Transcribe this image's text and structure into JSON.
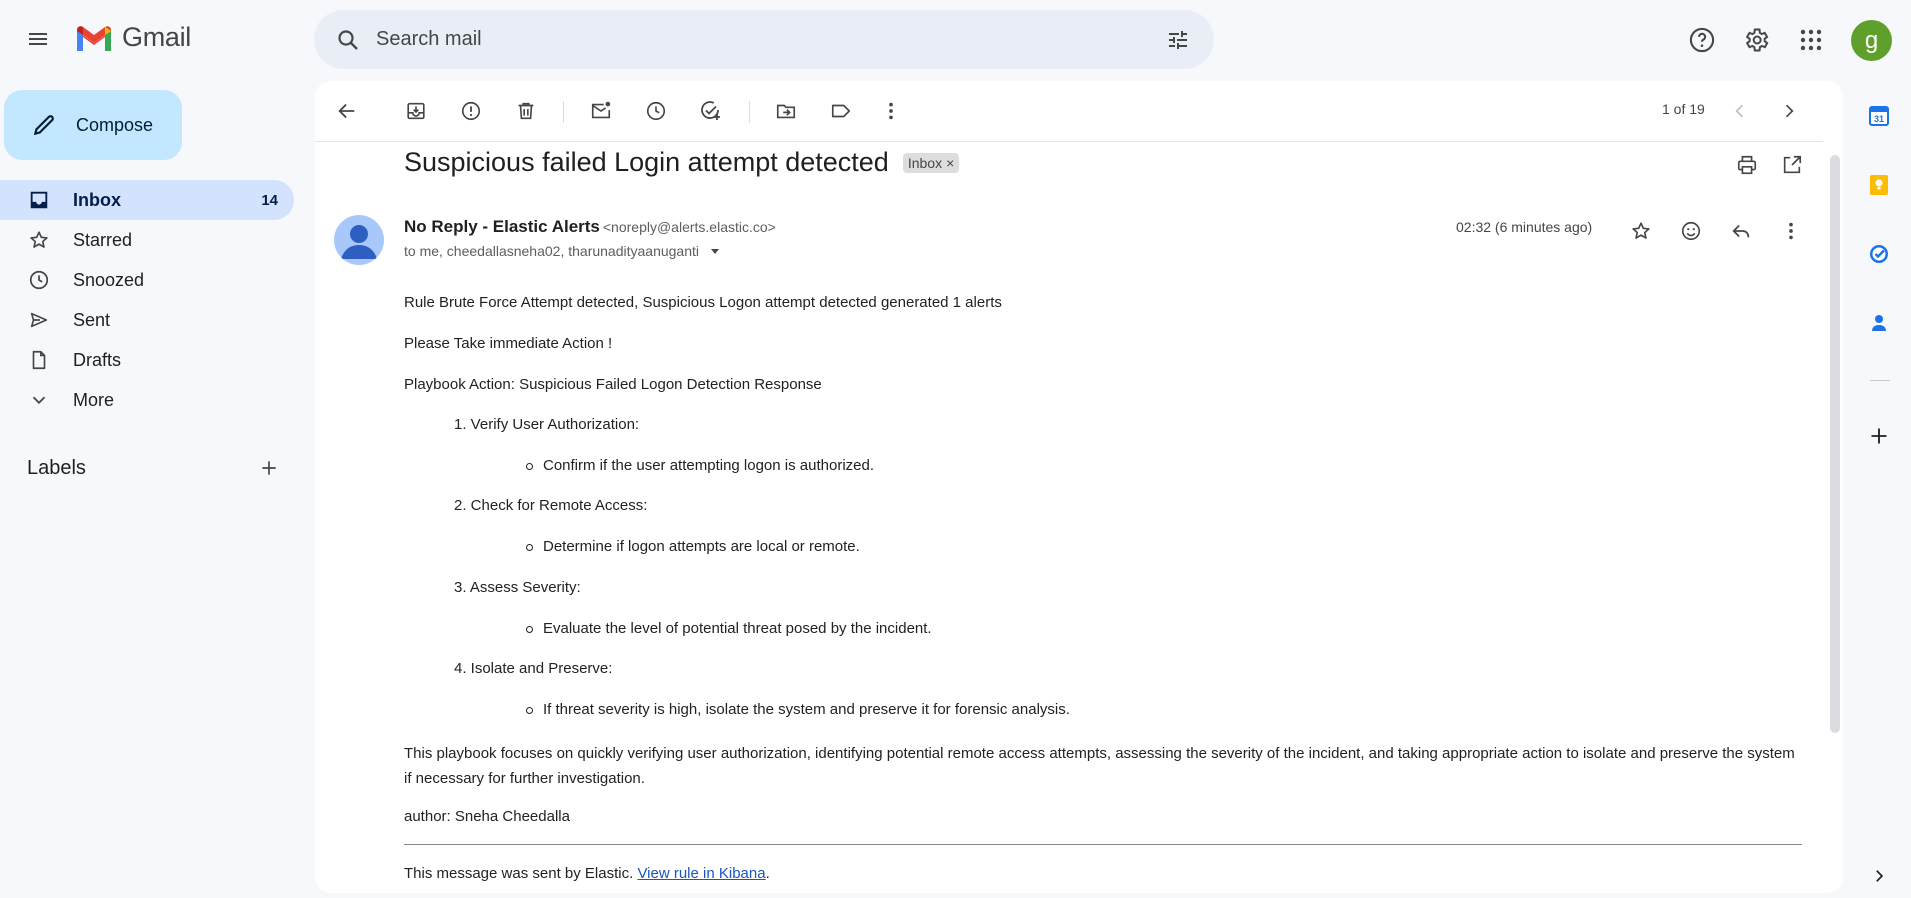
{
  "app": {
    "name": "Gmail"
  },
  "header": {
    "search_placeholder": "Search mail",
    "avatar_letter": "g"
  },
  "sidebar": {
    "compose_label": "Compose",
    "items": [
      {
        "label": "Inbox",
        "count": "14",
        "icon": "inbox-icon"
      },
      {
        "label": "Starred",
        "count": "",
        "icon": "star-icon"
      },
      {
        "label": "Snoozed",
        "count": "",
        "icon": "clock-icon"
      },
      {
        "label": "Sent",
        "count": "",
        "icon": "send-icon"
      },
      {
        "label": "Drafts",
        "count": "",
        "icon": "draft-icon"
      },
      {
        "label": "More",
        "count": "",
        "icon": "chevron-down-icon"
      }
    ],
    "labels_title": "Labels"
  },
  "toolbar": {
    "pager": "1 of 19"
  },
  "message": {
    "subject": "Suspicious failed Login attempt detected",
    "label_chip": "Inbox",
    "label_chip_close": "×",
    "sender_name": "No Reply - Elastic Alerts",
    "sender_email": "<noreply@alerts.elastic.co>",
    "recipients": "to me, cheedallasneha02, tharunadityaanuganti",
    "time": "02:32 (6 minutes ago)",
    "body": {
      "line1": "Rule Brute Force Attempt detected, Suspicious Logon attempt detected generated 1 alerts",
      "line2": "Please Take immediate Action !",
      "line3": "Playbook Action: Suspicious Failed Logon Detection Response",
      "steps": [
        {
          "title": "1. Verify User Authorization:",
          "detail": "Confirm if the user attempting logon is authorized."
        },
        {
          "title": "2. Check for Remote Access:",
          "detail": "Determine if logon attempts are local or remote."
        },
        {
          "title": "3. Assess Severity:",
          "detail": "Evaluate the level of potential threat posed by the incident."
        },
        {
          "title": "4. Isolate and Preserve:",
          "detail": "If threat severity is high, isolate the system and preserve it for forensic analysis."
        }
      ],
      "summary": "This playbook focuses on quickly verifying user authorization, identifying potential remote access attempts, assessing the severity of the incident, and taking appropriate action to isolate and preserve the system if necessary for further investigation.",
      "author": "author: Sneha Cheedalla"
    },
    "footer_text": "This message was sent by Elastic.",
    "footer_link": "View rule in Kibana",
    "footer_period": "."
  },
  "colors": {
    "background": "#f6f8fc",
    "compose": "#c2e7ff",
    "active_nav": "#d3e3fd",
    "avatar": "#5f9f2b",
    "link": "#1a55c0"
  }
}
